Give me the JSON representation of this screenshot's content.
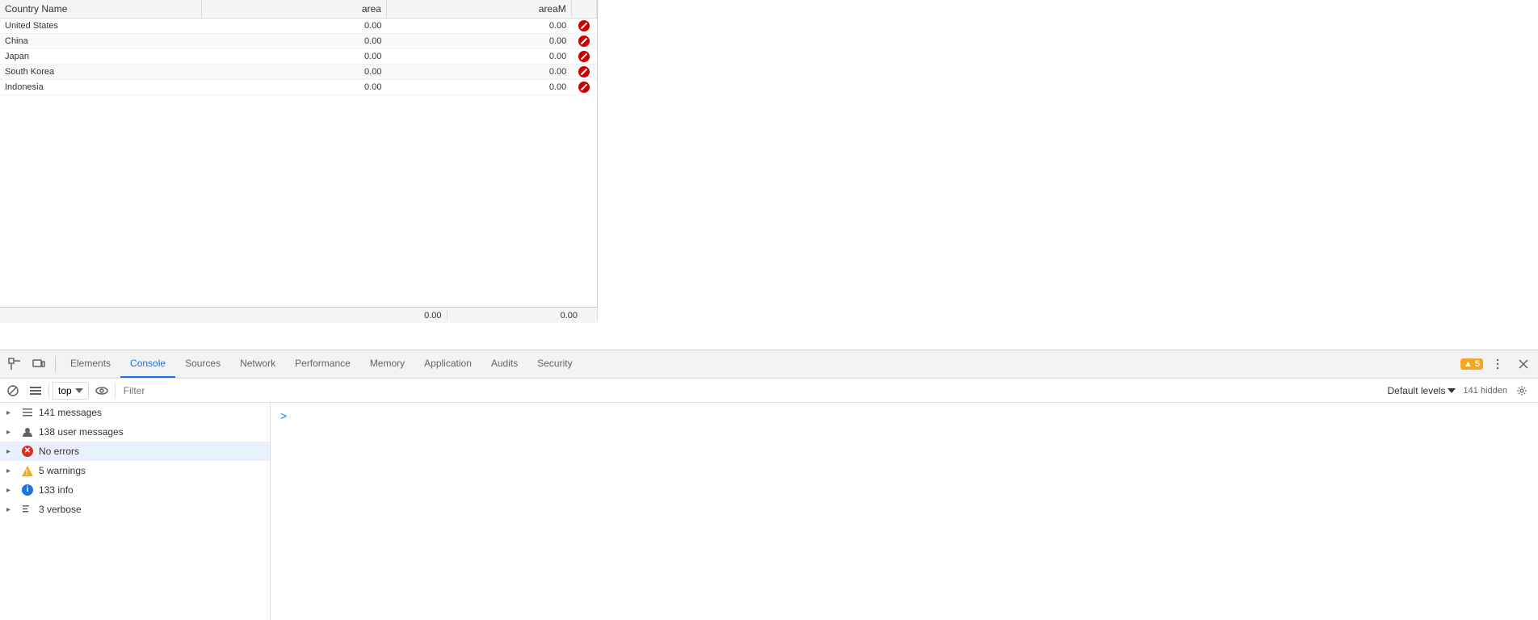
{
  "table": {
    "headers": [
      {
        "id": "country-name",
        "label": "Country Name",
        "align": "left"
      },
      {
        "id": "area",
        "label": "area",
        "align": "right"
      },
      {
        "id": "areaM",
        "label": "areaM",
        "align": "right"
      },
      {
        "id": "actions",
        "label": "",
        "align": "center"
      }
    ],
    "rows": [
      {
        "country": "United States",
        "area": "0.00",
        "areaM": "0.00"
      },
      {
        "country": "China",
        "area": "0.00",
        "areaM": "0.00"
      },
      {
        "country": "Japan",
        "area": "0.00",
        "areaM": "0.00"
      },
      {
        "country": "South Korea",
        "area": "0.00",
        "areaM": "0.00"
      },
      {
        "country": "Indonesia",
        "area": "0.00",
        "areaM": "0.00"
      }
    ],
    "footer": {
      "area_total": "0.00",
      "areaM_total": "0.00"
    }
  },
  "devtools": {
    "tabs": [
      {
        "id": "elements",
        "label": "Elements",
        "active": false
      },
      {
        "id": "console",
        "label": "Console",
        "active": true
      },
      {
        "id": "sources",
        "label": "Sources",
        "active": false
      },
      {
        "id": "network",
        "label": "Network",
        "active": false
      },
      {
        "id": "performance",
        "label": "Performance",
        "active": false
      },
      {
        "id": "memory",
        "label": "Memory",
        "active": false
      },
      {
        "id": "application",
        "label": "Application",
        "active": false
      },
      {
        "id": "audits",
        "label": "Audits",
        "active": false
      },
      {
        "id": "security",
        "label": "Security",
        "active": false
      }
    ],
    "warning_badge": "▲ 5",
    "hidden_count": "141 hidden"
  },
  "console_toolbar": {
    "context": "top",
    "filter_placeholder": "Filter",
    "default_levels": "Default levels",
    "hidden_count": "141 hidden"
  },
  "console_sidebar": {
    "items": [
      {
        "id": "all-messages",
        "label": "141 messages",
        "count": 141,
        "icon": "list",
        "expanded": false,
        "selected": false
      },
      {
        "id": "user-messages",
        "label": "138 user messages",
        "count": 138,
        "icon": "user",
        "expanded": false,
        "selected": false
      },
      {
        "id": "errors",
        "label": "No errors",
        "count": 0,
        "icon": "error",
        "expanded": false,
        "selected": true
      },
      {
        "id": "warnings",
        "label": "5 warnings",
        "count": 5,
        "icon": "warning",
        "expanded": false,
        "selected": false
      },
      {
        "id": "info",
        "label": "133 info",
        "count": 133,
        "icon": "info",
        "expanded": false,
        "selected": false
      },
      {
        "id": "verbose",
        "label": "3 verbose",
        "count": 3,
        "icon": "verbose",
        "expanded": false,
        "selected": false
      }
    ]
  }
}
